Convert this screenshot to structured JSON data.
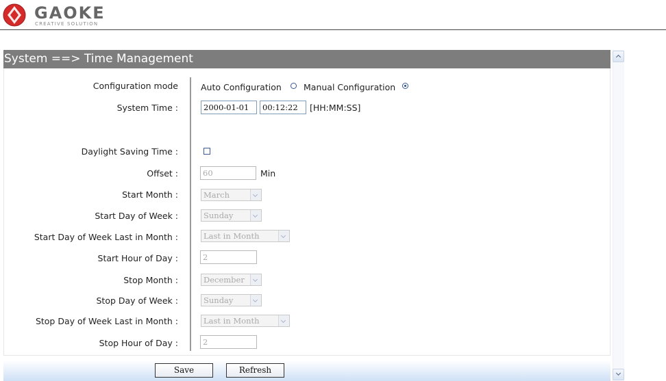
{
  "brand": {
    "name": "GAOKE",
    "tagline": "CREATIVE SOLUTION",
    "logo_color": "#d42a2a"
  },
  "panel": {
    "title": "System ==> Time Management"
  },
  "form": {
    "config_mode": {
      "label": "Configuration mode",
      "option_auto": "Auto Configuration",
      "option_manual": "Manual Configuration",
      "selected": "Manual Configuration"
    },
    "system_time": {
      "label": "System Time :",
      "date": "2000-01-01",
      "time": "00:12:22",
      "format": "[HH:MM:SS]"
    },
    "daylight_saving": {
      "label": "Daylight Saving Time :",
      "checked": false
    },
    "offset": {
      "label": "Offset :",
      "value": "60",
      "unit": "Min"
    },
    "start_month": {
      "label": "Start Month :",
      "value": "March"
    },
    "start_day_of_week": {
      "label": "Start Day of Week :",
      "value": "Sunday"
    },
    "start_day_of_week_last": {
      "label": "Start Day of Week Last in Month :",
      "value": "Last in Month"
    },
    "start_hour": {
      "label": "Start Hour of Day :",
      "value": "2"
    },
    "stop_month": {
      "label": "Stop Month :",
      "value": "December"
    },
    "stop_day_of_week": {
      "label": "Stop Day of Week :",
      "value": "Sunday"
    },
    "stop_day_of_week_last": {
      "label": "Stop Day of Week Last in Month :",
      "value": "Last in Month"
    },
    "stop_hour": {
      "label": "Stop Hour of Day :",
      "value": "2"
    }
  },
  "buttons": {
    "save": "Save",
    "refresh": "Refresh"
  }
}
